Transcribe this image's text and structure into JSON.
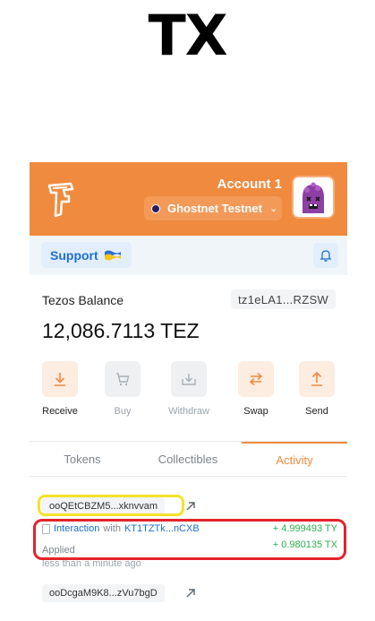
{
  "big_title": "TX",
  "header": {
    "account_name": "Account 1",
    "network_label": "Ghostnet Testnet",
    "brand_color": "#f08a3e"
  },
  "support": {
    "label": "Support",
    "flag": "Ukraine flag"
  },
  "balance": {
    "label": "Tezos Balance",
    "address": "tz1eLA1...RZSW",
    "value": "12,086.7113 TEZ"
  },
  "actions": [
    {
      "label": "Receive",
      "icon": "download-icon",
      "enabled": true
    },
    {
      "label": "Buy",
      "icon": "cart-icon",
      "enabled": false
    },
    {
      "label": "Withdraw",
      "icon": "withdraw-icon",
      "enabled": false
    },
    {
      "label": "Swap",
      "icon": "swap-icon",
      "enabled": true
    },
    {
      "label": "Send",
      "icon": "upload-icon",
      "enabled": true
    }
  ],
  "tabs": [
    {
      "label": "Tokens",
      "active": false
    },
    {
      "label": "Collectibles",
      "active": false
    },
    {
      "label": "Activity",
      "active": true
    }
  ],
  "activity": {
    "first_hash": "ooQEtCBZM5...xknvvam",
    "tx": {
      "type": "Interaction",
      "with_word": "with",
      "contract": "KT1TZTk...nCXB",
      "status": "Applied",
      "time": "less than a minute ago",
      "amounts": [
        "+ 4.999493 TY",
        "+ 0.980135 TX"
      ]
    },
    "second_hash": "ooDcgaM9K8...zVu7bgD"
  },
  "annotation_colors": {
    "yellow": "#f5e22b",
    "red": "#e3232b"
  }
}
